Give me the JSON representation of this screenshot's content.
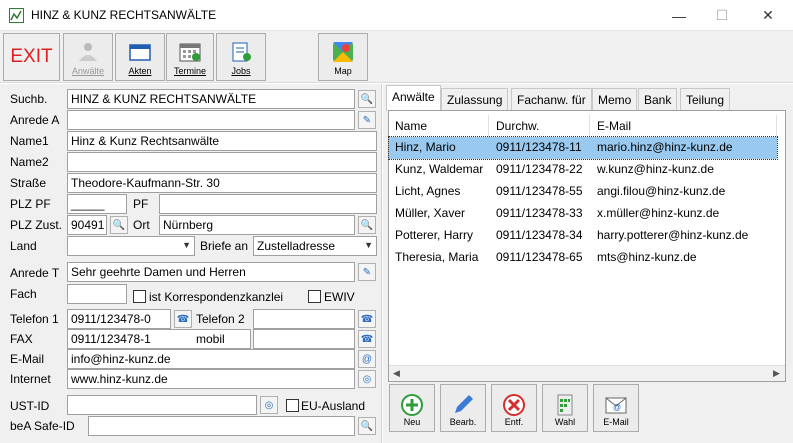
{
  "window": {
    "title": "HINZ & KUNZ RECHTSANWÄLTE",
    "minimize": "—",
    "maximize": "☐",
    "close": "✕"
  },
  "toolbar": {
    "exit": "EXIT",
    "anwaelte": "Anwälte",
    "akten": "Akten",
    "termine": "Termine",
    "jobs": "Jobs",
    "map": "Map"
  },
  "form": {
    "suchb_label": "Suchb.",
    "suchb_value": "HINZ & KUNZ RECHTSANWÄLTE",
    "anrede_a_label": "Anrede A",
    "anrede_a_value": "",
    "name1_label": "Name1",
    "name1_value": "Hinz & Kunz Rechtsanwälte",
    "name2_label": "Name2",
    "name2_value": "",
    "strasse_label": "Straße",
    "strasse_value": "Theodore-Kaufmann-Str. 30",
    "plzpf_label": "PLZ PF",
    "plzpf_value": "_____",
    "pf_label": "PF",
    "pf_value": "",
    "plzzust_label": "PLZ Zust.",
    "plzzust_value": "90491",
    "ort_label": "Ort",
    "ort_value": "Nürnberg",
    "land_label": "Land",
    "land_value": "",
    "briefe_label": "Briefe an",
    "briefe_value": "Zustelladresse",
    "anrede_t_label": "Anrede T",
    "anrede_t_value": "Sehr geehrte Damen und Herren",
    "fach_label": "Fach",
    "fach_value": "",
    "korr_label": "ist Korrespondenzkanzlei",
    "ewiv_label": "EWIV",
    "telefon1_label": "Telefon 1",
    "telefon1_value": "0911/123478-0",
    "telefon2_label": "Telefon 2",
    "telefon2_value": "",
    "fax_label": "FAX",
    "fax_value": "0911/123478-1",
    "mobil_label": "mobil",
    "mobil_value": "",
    "email_label": "E-Mail",
    "email_value": "info@hinz-kunz.de",
    "internet_label": "Internet",
    "internet_value": "www.hinz-kunz.de",
    "ustid_label": "UST-ID",
    "ustid_value": "",
    "euausland_label": "EU-Ausland",
    "bea_label": "beA Safe-ID",
    "bea_value": ""
  },
  "tabs": [
    "Anwälte",
    "Zulassung",
    "Fachanw. für",
    "Memo",
    "Bank",
    "Teilung"
  ],
  "grid": {
    "headers": [
      "Name",
      "Durchw.",
      "E-Mail"
    ],
    "rows": [
      [
        "Hinz, Mario",
        "0911/123478-11",
        "mario.hinz@hinz-kunz.de"
      ],
      [
        "Kunz, Waldemar",
        "0911/123478-22",
        "w.kunz@hinz-kunz.de"
      ],
      [
        "Licht, Agnes",
        "0911/123478-55",
        "angi.filou@hinz-kunz.de"
      ],
      [
        "Müller, Xaver",
        "0911/123478-33",
        "x.müller@hinz-kunz.de"
      ],
      [
        "Potterer, Harry",
        "0911/123478-34",
        "harry.potterer@hinz-kunz.de"
      ],
      [
        "Theresia, Maria",
        "0911/123478-65",
        "mts@hinz-kunz.de"
      ]
    ]
  },
  "bottom": {
    "neu": "Neu",
    "bearb": "Bearb.",
    "entf": "Entf.",
    "wahl": "Wahl",
    "email": "E-Mail"
  },
  "colors": {
    "selected_row": "#99c9ef",
    "exit_red": "#e02020"
  }
}
